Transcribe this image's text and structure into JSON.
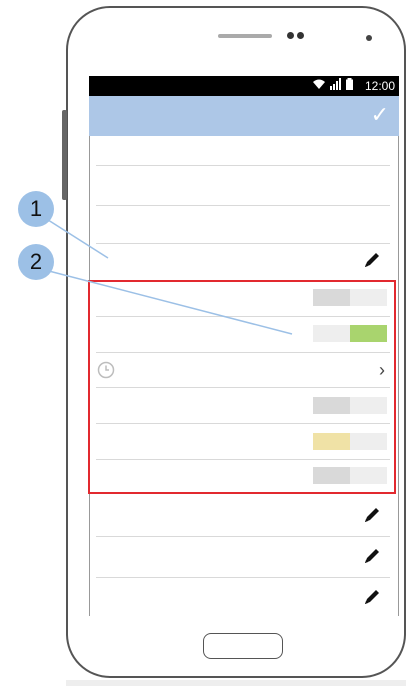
{
  "status_bar": {
    "time": "12:00",
    "icons": [
      "wifi-icon",
      "signal-icon",
      "battery-icon"
    ]
  },
  "app_bar": {
    "color": "#adc7e7",
    "action_icon": "check-icon"
  },
  "highlight": {
    "color": "#e2292f"
  },
  "callouts": [
    {
      "number": "1",
      "color": "#9cc0e6"
    },
    {
      "number": "2",
      "color": "#9cc0e6"
    }
  ],
  "rows": {
    "bars": [
      {
        "fill_color": "#d9d9d9",
        "fill_fraction": 0.5,
        "fill_side": "left"
      },
      {
        "fill_color": "#a9d46e",
        "fill_fraction": 0.5,
        "fill_side": "right"
      },
      {
        "fill_color": "#d9d9d9",
        "fill_fraction": 0.5,
        "fill_side": "left"
      },
      {
        "fill_color": "#f0e2a6",
        "fill_fraction": 0.5,
        "fill_side": "left"
      },
      {
        "fill_color": "#d9d9d9",
        "fill_fraction": 0.5,
        "fill_side": "left"
      }
    ],
    "icons": [
      "pencil-icon",
      "clock-icon",
      "chevron-right-icon"
    ]
  }
}
